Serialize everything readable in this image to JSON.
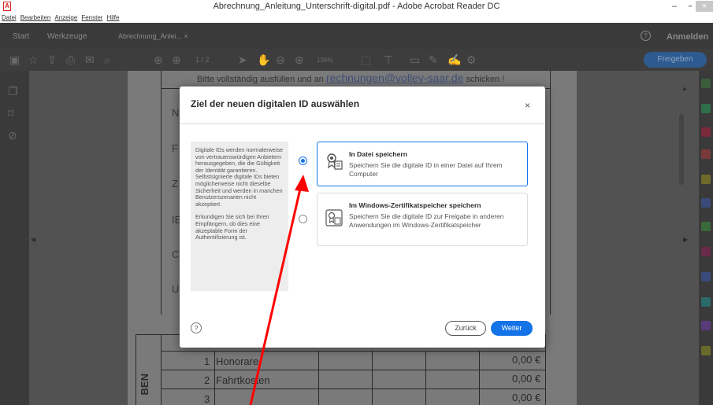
{
  "window": {
    "title": "Abrechnung_Anleitung_Unterschrift-digital.pdf - Adobe Acrobat Reader DC",
    "controls": {
      "minimize": "–",
      "maximize": "▫",
      "close": "×"
    }
  },
  "menu": [
    "Datei",
    "Bearbeiten",
    "Anzeige",
    "Fenster",
    "Hilfe"
  ],
  "tabs": {
    "start": "Start",
    "tools": "Werkzeuge",
    "document": "Abrechnung_Anlei... ×"
  },
  "header": {
    "help": "?",
    "signin": "Anmelden"
  },
  "toolbar": {
    "page_indicator": "1 / 2",
    "zoom": "136%",
    "share": "Freigeben"
  },
  "document": {
    "instruction_pre": "Bitte vollständig ausfüllen und an ",
    "instruction_link": "rechnungen@volley-saar.de",
    "instruction_post": " schicken !",
    "side_letters": [
      "N",
      "F",
      "Z",
      "IE",
      "C",
      "U"
    ],
    "vertical_label": "BEN",
    "rows": [
      {
        "num": "1",
        "label": "Honorare",
        "amount": "0,00 €"
      },
      {
        "num": "2",
        "label": "Fahrtkosten",
        "amount": "0,00 €"
      },
      {
        "num": "3",
        "label": "",
        "amount": "0,00 €"
      }
    ]
  },
  "dialog": {
    "title": "Ziel der neuen digitalen ID auswählen",
    "close": "×",
    "info_paragraph1": "Digitale IDs werden normalerweise von vertrauenswürdigen Anbietern herausgegeben, die die Gültigkeit der Identität garantieren. Selbstsignierte digitale IDs bieten möglicherweise nicht dieselbe Sicherheit und werden in manchen Benutzerszenarien nicht akzeptiert.",
    "info_paragraph2": "Erkundigen Sie sich bei Ihren Empfängern, ob dies eine akzeptable Form der Authentifizierung ist.",
    "options": [
      {
        "title": "In Datei speichern",
        "description": "Speichern Sie die digitale ID in einer Datei auf Ihrem Computer",
        "selected": true
      },
      {
        "title": "Im Windows-Zertifikatspeicher speichern",
        "description": "Speichern Sie die digitale ID zur Freigabe in anderen Anwendungen im Windows-Zertifikatspeicher",
        "selected": false
      }
    ],
    "help": "?",
    "back": "Zurück",
    "next": "Weiter"
  },
  "colors": {
    "accent": "#1473e6",
    "annotation_arrow": "#ff0000",
    "brand": "#d9231e"
  }
}
